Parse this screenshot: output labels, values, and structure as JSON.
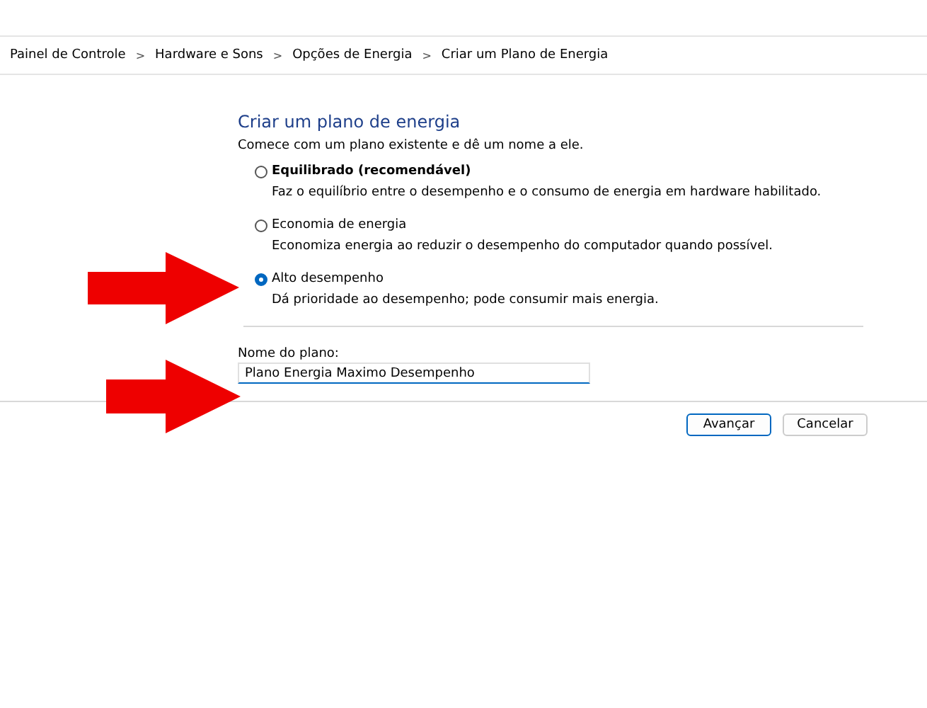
{
  "breadcrumb": [
    "Painel de Controle",
    "Hardware e Sons",
    "Opções de Energia",
    "Criar um Plano de Energia"
  ],
  "breadcrumb_separator": ">",
  "title": "Criar um plano de energia",
  "intro": "Comece com um plano existente e dê um nome a ele.",
  "plans": [
    {
      "label": "Equilibrado (recomendável)",
      "description": "Faz o equilíbrio entre o desempenho e o consumo de energia em hardware habilitado.",
      "selected": false,
      "bold": true
    },
    {
      "label": "Economia de energia",
      "description": "Economiza energia ao reduzir o desempenho do computador quando possível.",
      "selected": false,
      "bold": false
    },
    {
      "label": "Alto desempenho",
      "description": "Dá prioridade ao desempenho; pode consumir mais energia.",
      "selected": true,
      "bold": false
    }
  ],
  "plan_name": {
    "label": "Nome do plano:",
    "value": "Plano Energia Maximo Desempenho"
  },
  "buttons": [
    {
      "label": "Avançar",
      "default": true
    },
    {
      "label": "Cancelar",
      "default": false
    }
  ]
}
